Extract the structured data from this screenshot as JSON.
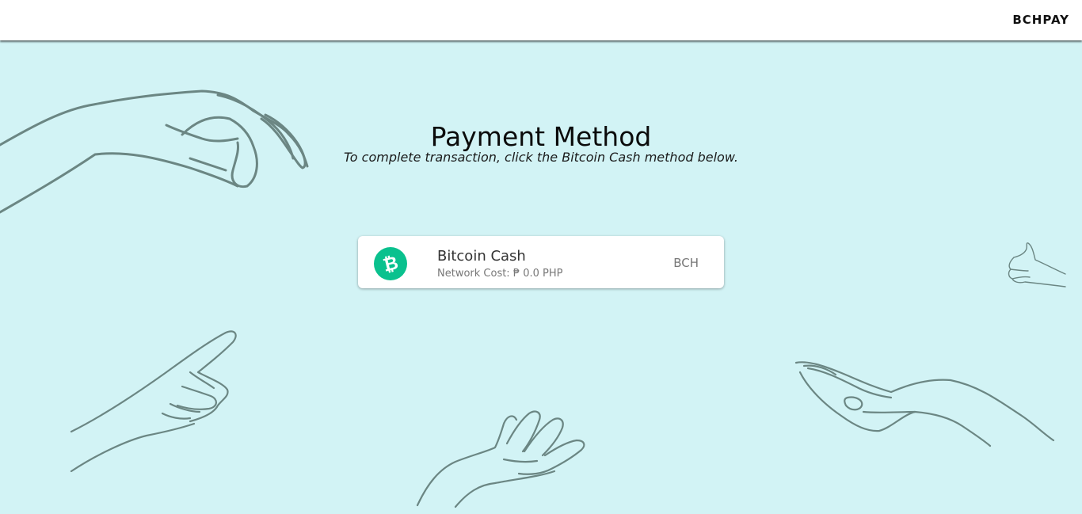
{
  "header": {
    "brand": "BCHPAY"
  },
  "main": {
    "title": "Payment Method",
    "subtitle": "To complete transaction, click the Bitcoin Cash method below."
  },
  "payment_method": {
    "name": "Bitcoin Cash",
    "network_cost": "Network Cost: ₱ 0.0 PHP",
    "ticker": "BCH",
    "icon": "bitcoin-cash-icon",
    "icon_color": "#0ac18e"
  },
  "colors": {
    "background": "#d2f3f5",
    "line_art": "#6b8683"
  }
}
